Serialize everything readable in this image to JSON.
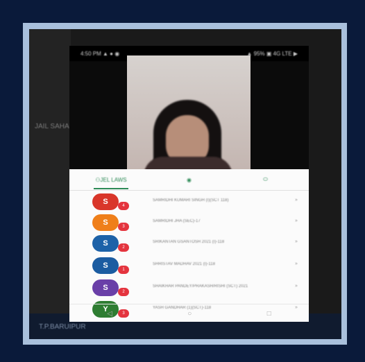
{
  "left_panel": {
    "label": "JAIL SAHAB"
  },
  "bottom": {
    "label": "T.P.BARUIPUR"
  },
  "phone": {
    "status": {
      "left": "4:50 PM ▲ ● ◉",
      "right": "▲ 95% ▣ 4G LTE ▶"
    },
    "tabs": [
      {
        "label": "JEL LAWS",
        "icon": "people-icon"
      },
      {
        "label": "",
        "icon": "whatsapp-icon"
      },
      {
        "label": "",
        "icon": "phone-icon"
      }
    ],
    "rows": [
      {
        "avatar_letter": "S",
        "avatar_color": "#d9362a",
        "badge": "4",
        "label": "SAMRIDHI KUMARI SINGH (I)(SCT 118)",
        "chevron": "»"
      },
      {
        "avatar_letter": "S",
        "avatar_color": "#ef7f1a",
        "badge": "3",
        "label": "SAMRIDHI JHA (SEC)-17",
        "chevron": "»"
      },
      {
        "avatar_letter": "S",
        "avatar_color": "#1d62a8",
        "badge": "2",
        "label": "SRIKANTAN GSANTOSH 2021 (I)-118",
        "chevron": "»"
      },
      {
        "avatar_letter": "S",
        "avatar_color": "#1b5ca1",
        "badge": "1",
        "label": "SHRISTAV MADHAV 2021 (I)-118",
        "chevron": "»"
      },
      {
        "avatar_letter": "S",
        "avatar_color": "#6a3fa8",
        "badge": "2",
        "label": "SHAIKHAR PANDEY/PRAKASH/RISHI (SCT) 2021",
        "chevron": "»"
      },
      {
        "avatar_letter": "Y",
        "avatar_color": "#2e7d32",
        "badge": "3",
        "label": "YASH GANDHAR (1)(SCT)-118",
        "chevron": "»"
      }
    ],
    "nav": [
      {
        "icon": "back-icon",
        "glyph": "◁"
      },
      {
        "icon": "home-icon",
        "glyph": "○"
      },
      {
        "icon": "recent-apps-icon",
        "glyph": "□"
      }
    ]
  }
}
